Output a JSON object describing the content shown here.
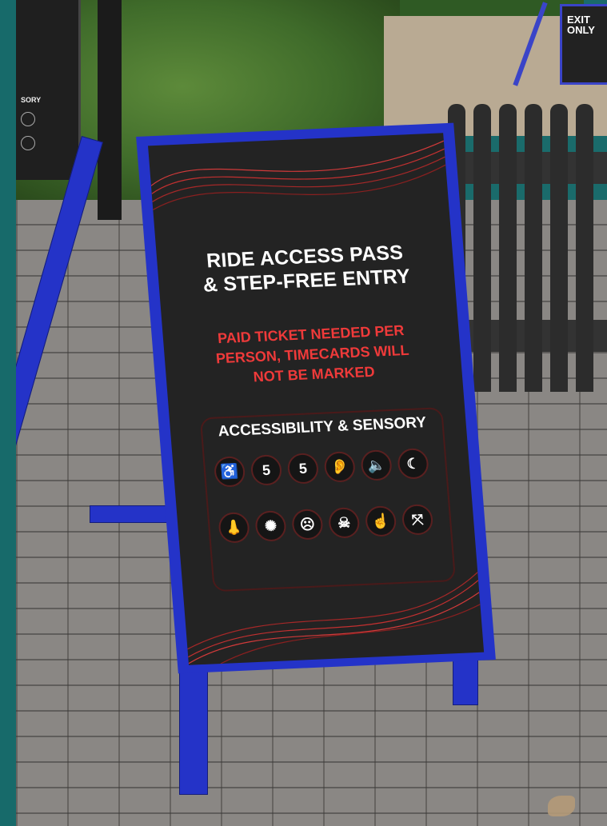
{
  "scene": {
    "exit_sign": {
      "line1": "EXIT",
      "line2": "ONLY"
    },
    "left_sign": {
      "heading": "SORY"
    }
  },
  "sign": {
    "title_line1": "RIDE ACCESS PASS",
    "title_line2": "& STEP-FREE ENTRY",
    "notice_line1": "PAID TICKET NEEDED PER",
    "notice_line2": "PERSON, TIMECARDS WILL",
    "notice_line3": "NOT BE MARKED",
    "accessibility_heading": "ACCESSIBILITY & SENSORY",
    "icons_row1": [
      {
        "name": "wheelchair-icon",
        "glyph": "♿"
      },
      {
        "name": "access-rating-icon",
        "glyph": "5"
      },
      {
        "name": "sensory-rating-icon",
        "glyph": "5"
      },
      {
        "name": "loud-noise-icon",
        "glyph": "👂"
      },
      {
        "name": "sudden-noise-icon",
        "glyph": "🔈"
      },
      {
        "name": "dark-spaces-icon",
        "glyph": "☾"
      }
    ],
    "icons_row2": [
      {
        "name": "smell-icon",
        "glyph": "👃"
      },
      {
        "name": "strobe-lighting-icon",
        "glyph": "✺"
      },
      {
        "name": "scare-icon",
        "glyph": "☹"
      },
      {
        "name": "skull-icon",
        "glyph": "☠"
      },
      {
        "name": "touch-icon",
        "glyph": "☝"
      },
      {
        "name": "confined-space-icon",
        "glyph": "⤧"
      }
    ]
  },
  "colors": {
    "frame_blue": "#2433c8",
    "board_black": "#232323",
    "notice_red": "#ef3a3a",
    "title_white": "#ffffff"
  }
}
